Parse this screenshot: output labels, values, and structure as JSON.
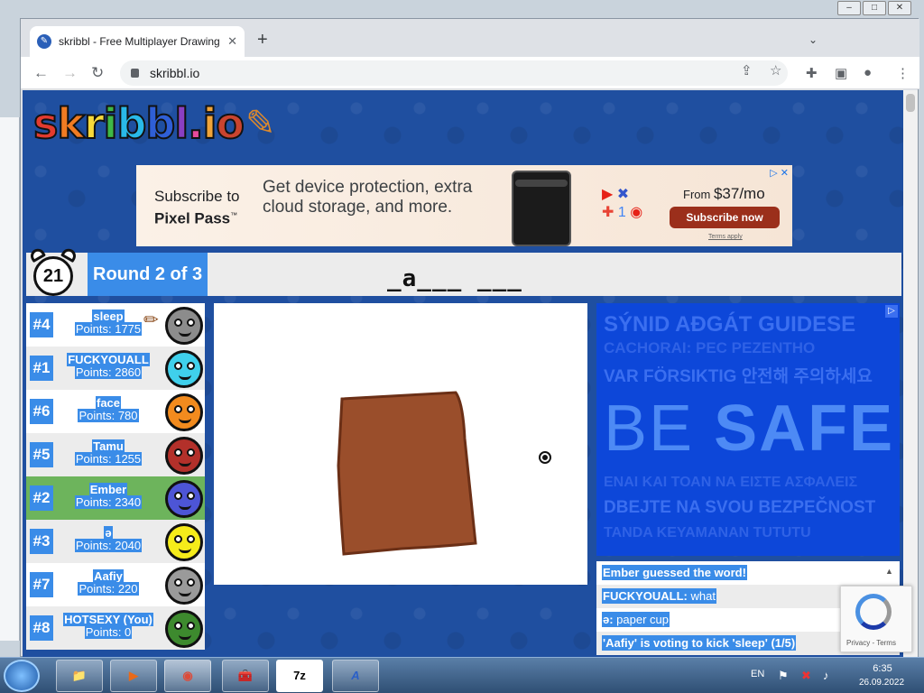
{
  "browser": {
    "tab_title": "skribbl - Free Multiplayer Drawing",
    "tab_close": "✕",
    "new_tab": "+",
    "url": "skribbl.io",
    "window_controls": [
      "–",
      "□",
      "✕"
    ]
  },
  "logo": {
    "text": "skribbl.io",
    "letters": [
      {
        "ch": "s",
        "color": "#e23b2e"
      },
      {
        "ch": "k",
        "color": "#f07b22"
      },
      {
        "ch": "r",
        "color": "#f7d93b"
      },
      {
        "ch": "i",
        "color": "#3fb846"
      },
      {
        "ch": "b",
        "color": "#29b9e8"
      },
      {
        "ch": "b",
        "color": "#2f5fd6"
      },
      {
        "ch": "l",
        "color": "#8a3fc2"
      },
      {
        "ch": ".",
        "color": "#e84b9b"
      },
      {
        "ch": "i",
        "color": "#f0a43a"
      },
      {
        "ch": "o",
        "color": "#c9442f"
      }
    ]
  },
  "ad_top": {
    "subscribe_line1": "Subscribe to",
    "subscribe_brand": "Pixel Pass",
    "subscribe_tm": "™",
    "pitch": "Get device protection, extra cloud storage, and more.",
    "price_prefix": "From ",
    "price": "$37/mo",
    "cta": "Subscribe now",
    "terms": "Terms apply",
    "adchoices": "▷ ✕"
  },
  "game": {
    "timer": "21",
    "round": "Round 2 of 3",
    "word_hint": "_a___ ___"
  },
  "players": [
    {
      "rank": "#4",
      "name": "sleep",
      "points": "Points: 1775",
      "color": "#8c8c8c",
      "drawing": true
    },
    {
      "rank": "#1",
      "name": "FUCKYOUALL",
      "points": "Points: 2860",
      "color": "#3fd0ec",
      "drawing": false
    },
    {
      "rank": "#6",
      "name": "face",
      "points": "Points: 780",
      "color": "#f28b1e",
      "drawing": false
    },
    {
      "rank": "#5",
      "name": "Tamu",
      "points": "Points: 1255",
      "color": "#b3302a",
      "drawing": false
    },
    {
      "rank": "#2",
      "name": "Ember",
      "points": "Points: 2340",
      "color": "#4d55d6",
      "drawing": false,
      "guessed": true
    },
    {
      "rank": "#3",
      "name": "ə",
      "points": "Points: 2040",
      "color": "#f5ec1a",
      "drawing": false
    },
    {
      "rank": "#7",
      "name": "Aafiy",
      "points": "Points: 220",
      "color": "#9a9a9a",
      "drawing": false
    },
    {
      "rank": "#8",
      "name": "HOTSEXY (You)",
      "points": "Points: 0",
      "color": "#3d8a2e",
      "drawing": false
    }
  ],
  "canvas": {
    "shape_fill": "#9a4e2b",
    "shape_stroke": "#6b2f16"
  },
  "ad_right": {
    "lines": [
      "SÝNID AÐGÁT GUIDESE",
      "CACHORAI: PEC PEZENTHO",
      "VAR FÖRSIKTIG 안전해 주의하세요",
      "BE SAFE",
      "ΕΝΑΙ ΚΑΙ ΤΟΑΝ ΝΑ ΕΙΣΤΕ ΑΣΦΑΛΕΙΣ",
      "DBEJTE NA SVOU BEZPEČNOST",
      "TANDA KEYAMANAN TUTUTU"
    ],
    "be": "BE ",
    "safe": "SAFE"
  },
  "chat": [
    {
      "who": "",
      "text": "Ember guessed the word!",
      "sys": true
    },
    {
      "who": "FUCKYOUALL:",
      "text": " what",
      "sys": false
    },
    {
      "who": "ə:",
      "text": " paper cup",
      "sys": false
    },
    {
      "who": "",
      "text": "'Aafiy' is voting to kick 'sleep' (1/5)",
      "sys": true
    }
  ],
  "recaptcha": {
    "text": "Privacy - Terms"
  },
  "taskbar": {
    "apps": [
      "📁",
      "▶",
      "◉",
      "🧰",
      "7z",
      "A"
    ],
    "lang": "EN",
    "time": "6:35",
    "date": "26.09.2022"
  }
}
